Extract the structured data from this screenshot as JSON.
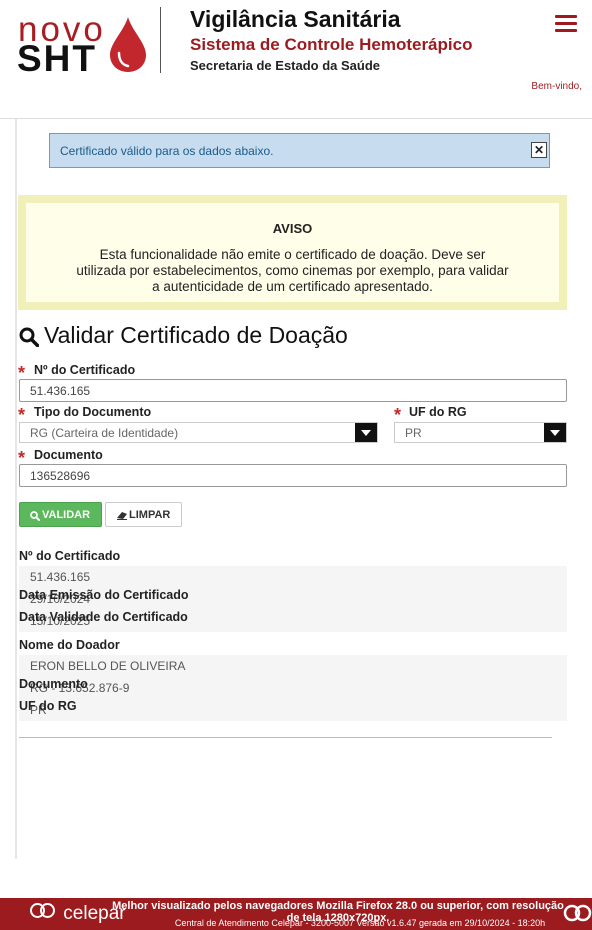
{
  "header": {
    "logo_top": "novo",
    "logo_bottom": "SHT",
    "title": "Vigilância Sanitária",
    "subtitle": "Sistema de Controle Hemoterápico",
    "department": "Secretaria de Estado da Saúde",
    "welcome": "Bem-vindo,"
  },
  "alert": {
    "message": "Certificado válido para os dados abaixo.",
    "close_label": "✕"
  },
  "aviso": {
    "title": "AVISO",
    "text": "Esta funcionalidade não emite o certificado de doação. Deve ser utilizada por estabelecimentos, como cinemas por exemplo, para validar a autenticidade de um certificado apresentado."
  },
  "form": {
    "title": "Validar Certificado de Doação",
    "required_mark": "*",
    "certificado_label": "Nº do Certificado",
    "certificado_value": "51.436.165",
    "tipo_label": "Tipo do Documento",
    "tipo_value": "RG (Carteira de Identidade)",
    "uf_label": "UF do RG",
    "uf_value": "PR",
    "documento_label": "Documento",
    "documento_value": "136528696",
    "validar_label": "VALIDAR",
    "limpar_label": "LIMPAR"
  },
  "result": {
    "certificado_label": "Nº do Certificado",
    "certificado_value": "51.436.165",
    "emissao_label": "Data Emissão do Certificado",
    "emissao_value": "29/10/2024",
    "validade_label": "Data Validade do Certificado",
    "validade_value": "15/10/2025",
    "doador_label": "Nome do Doador",
    "doador_value": "ERON BELLO DE OLIVEIRA",
    "documento_label": "Documento",
    "documento_value": "RG - 13.652.876-9",
    "uf_label": "UF do RG",
    "uf_value": "PR"
  },
  "footer": {
    "brand": "celepar",
    "browser_notice": "Melhor visualizado pelos navegadores Mozilla Firefox 28.0 ou superior, com resolução de tela 1280x720px.",
    "contact_notice": "Central de Atendimento Celepar - 3200-5007  Versão v1.6.47 gerada em 29/10/2024 - 18:20h"
  },
  "colors": {
    "brand_red": "#9b1b1f",
    "success_green": "#5cb85c",
    "info_blue": "#c7ddef",
    "warning_yellow": "#f1f0b9"
  }
}
